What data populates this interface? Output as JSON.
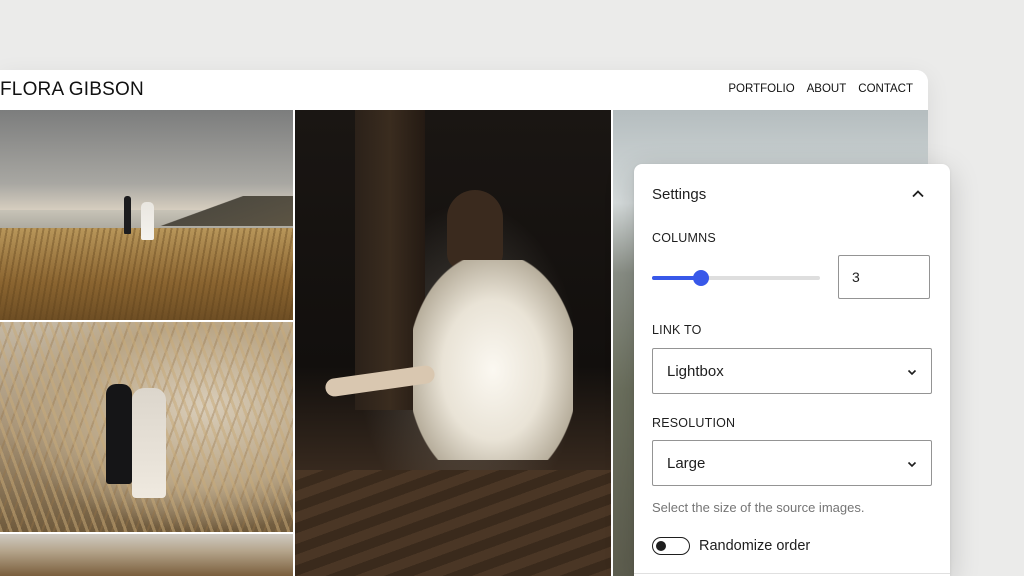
{
  "site": {
    "title": "FLORA GIBSON",
    "nav": [
      "PORTFOLIO",
      "ABOUT",
      "CONTACT"
    ]
  },
  "settings": {
    "heading": "Settings",
    "columns_label": "COLUMNS",
    "columns_value": "3",
    "columns_slider_fraction": 0.29,
    "link_to_label": "LINK TO",
    "link_to_value": "Lightbox",
    "resolution_label": "RESOLUTION",
    "resolution_value": "Large",
    "resolution_help": "Select the size of the source images.",
    "randomize_label": "Randomize order",
    "randomize_on": false
  },
  "colors": {
    "accent": "#3858e9",
    "text": "#1e1e1e",
    "help_text": "#757575",
    "background": "#ebebea"
  },
  "icons": {
    "collapse": "chevron-up-icon",
    "dropdown": "chevron-down-icon"
  }
}
